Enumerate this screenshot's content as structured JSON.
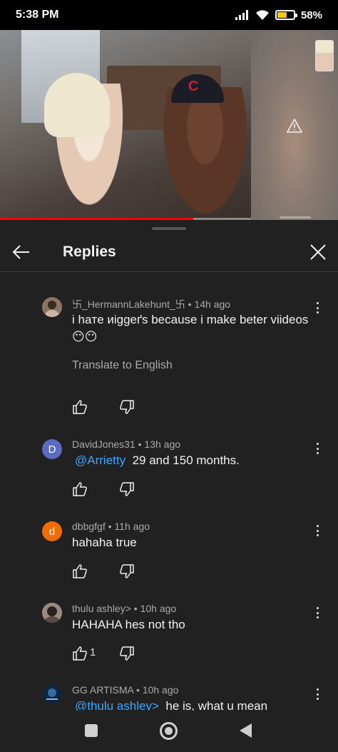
{
  "status_bar": {
    "time": "5:38 PM",
    "battery_percent": "58%",
    "battery_level": 0.58,
    "icons": [
      "signal-icon",
      "wifi-icon",
      "battery-icon"
    ]
  },
  "video": {
    "progress": 0.77,
    "cap_letter": "C"
  },
  "panel": {
    "title": "Replies"
  },
  "comments": [
    {
      "author": "卐_HermannLakehunt_卐",
      "time": "14h ago",
      "text": "i haтe иiggeґs because i make beter viideos 😶😶",
      "translate_label": "Translate to English",
      "avatar_color": "#6b5a4e",
      "likes": ""
    },
    {
      "author": "DavidJones31",
      "time": "13h ago",
      "mention": "@Arrietty",
      "text": "29 and 150 months.",
      "avatar_letter": "D",
      "avatar_color": "#5c6bc0",
      "likes": ""
    },
    {
      "author": "dbbgfgf",
      "time": "11h ago",
      "text": "hahaha true",
      "avatar_letter": "d",
      "avatar_color": "#ef6c00",
      "likes": ""
    },
    {
      "author": "thulu ashley>",
      "time": "10h ago",
      "text": "HAHAHA hes not tho",
      "avatar_color": "#7a6a62",
      "likes": "1"
    },
    {
      "author": "GG ARTISMA",
      "time": "10h ago",
      "mention": "@thulu ashley>",
      "text": "he is, what u mean",
      "avatar_color": "#1a3b5c",
      "likes": ""
    }
  ],
  "meta_separator": " • "
}
